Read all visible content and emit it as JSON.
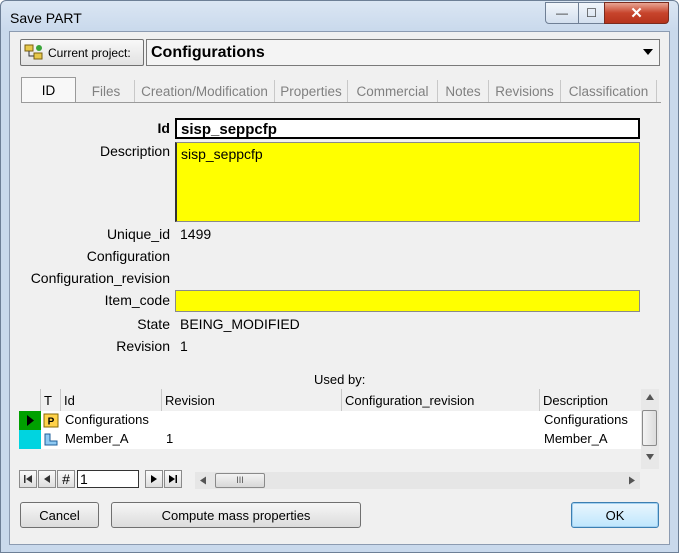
{
  "window": {
    "title": "Save  PART",
    "min_glyph": "—",
    "max_glyph": "☐",
    "close_glyph": "✕"
  },
  "project": {
    "button_label": "Current project:",
    "value": "Configurations"
  },
  "tabs": [
    {
      "label": "ID",
      "active": true
    },
    {
      "label": "Files"
    },
    {
      "label": "Creation/Modification"
    },
    {
      "label": "Properties"
    },
    {
      "label": "Commercial"
    },
    {
      "label": "Notes"
    },
    {
      "label": "Revisions"
    },
    {
      "label": "Classification"
    }
  ],
  "fields": {
    "id_label": "Id",
    "id_value": "sisp_seppcfp",
    "description_label": "Description",
    "description_value": "sisp_seppcfp",
    "unique_id_label": "Unique_id",
    "unique_id_value": "1499",
    "configuration_label": "Configuration",
    "configuration_revision_label": "Configuration_revision",
    "item_code_label": "Item_code",
    "state_label": "State",
    "state_value": "BEING_MODIFIED",
    "revision_label": "Revision",
    "revision_value": "1"
  },
  "used_by": {
    "title": "Used by:",
    "columns": [
      "T",
      "Id",
      "Revision",
      "Configuration_revision",
      "Description"
    ],
    "rows": [
      {
        "type_icon": "project-p-icon",
        "id": "Configurations",
        "revision": "",
        "configuration_revision": "",
        "description": "Configurations"
      },
      {
        "type_icon": "part-icon",
        "id": "Member_A",
        "revision": "1",
        "configuration_revision": "",
        "description": "Member_A"
      }
    ]
  },
  "navigator": {
    "hash": "#",
    "record": "1",
    "hscroll_grip": "III"
  },
  "buttons": {
    "cancel": "Cancel",
    "compute": "Compute mass properties",
    "ok": "OK"
  },
  "colors": {
    "required_field": "#ffff00",
    "row_indicator": "#00d4e0",
    "current_row_marker": "#00a000"
  }
}
